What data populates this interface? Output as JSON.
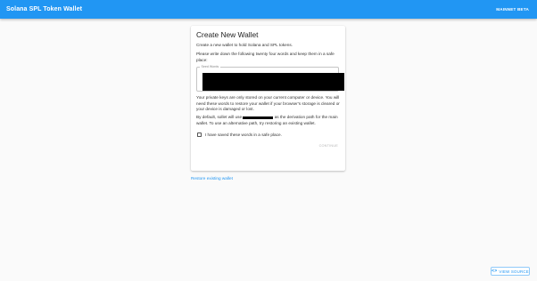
{
  "appbar": {
    "title": "Solana SPL Token Wallet",
    "network_label": "MAINNET BETA",
    "color": "#2196f3"
  },
  "card": {
    "title": "Create New Wallet",
    "intro": "Create a new wallet to hold Solana and SPL tokens.",
    "instructions": "Please write down the following twenty four words and keep them in a safe place:",
    "seed_field": {
      "label": "Seed Words",
      "value": ""
    },
    "warning": "Your private keys are only stored on your current computer or device. You will need these words to restore your wallet if your browser's storage is cleared or your device is damaged or lost.",
    "derivation_prefix": "By default, sollet will use",
    "derivation_path": "",
    "derivation_suffix": "as the derivation path for the main wallet. To use an alternative path, try restoring an existing wallet.",
    "checkbox_label": "I have saved these words in a safe place.",
    "checkbox_checked": false,
    "continue_label": "CONTINUE"
  },
  "restore_link": "Restore existing wallet",
  "view_source": {
    "icon": "code-icon",
    "label": "VIEW SOURCE"
  }
}
